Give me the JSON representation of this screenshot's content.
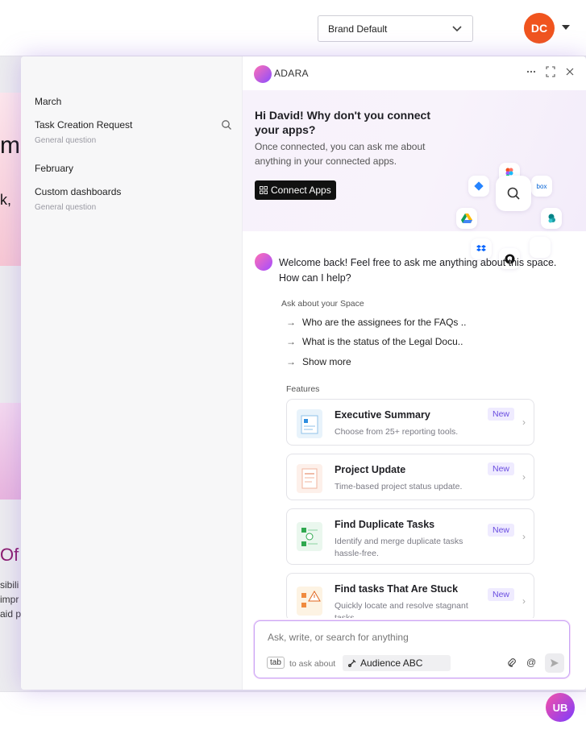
{
  "topbar": {
    "brand_select": "Brand Default",
    "avatar_initials": "DC"
  },
  "background": {
    "fragments": [
      "m",
      "k,",
      "Of",
      "sibili",
      "impr",
      "aid p"
    ]
  },
  "ub_badge": "UB",
  "history": {
    "groups": [
      {
        "month": "March",
        "items": [
          {
            "title": "Task Creation Request",
            "subtitle": "General question"
          }
        ]
      },
      {
        "month": "February",
        "items": [
          {
            "title": "Custom dashboards",
            "subtitle": "General question"
          }
        ]
      }
    ]
  },
  "chat": {
    "brand": "ADARA",
    "promo": {
      "title": "Hi David! Why don't you connect your apps?",
      "description": "Once connected, you can ask me about anything in your connected apps.",
      "button": "Connect Apps",
      "box_label": "box"
    },
    "welcome": "Welcome back! Feel free to ask me anything about this space. How can I help?",
    "ask_label": "Ask about your Space",
    "suggestions": [
      "Who are the assignees for the FAQs ..",
      "What is the status of the Legal Docu..",
      "Show more"
    ],
    "features_label": "Features",
    "features": [
      {
        "title": "Executive Summary",
        "desc": "Choose from 25+ reporting tools.",
        "badge": "New"
      },
      {
        "title": "Project Update",
        "desc": "Time-based project status update.",
        "badge": "New"
      },
      {
        "title": "Find Duplicate Tasks",
        "desc": "Identify and merge duplicate tasks hassle-free.",
        "badge": "New"
      },
      {
        "title": "Find tasks That Are Stuck",
        "desc": "Quickly locate and resolve stagnant tasks.",
        "badge": "New"
      }
    ],
    "input": {
      "placeholder": "Ask, write, or search for anything",
      "tab_chip": "tab",
      "ask_about": "to ask about",
      "audience": "Audience ABC"
    }
  },
  "colors": {
    "accent": "#6a4de0",
    "avatar": "#f0541e",
    "brand_gradient_start": "#ff6fb5",
    "brand_gradient_end": "#8a4dff"
  }
}
